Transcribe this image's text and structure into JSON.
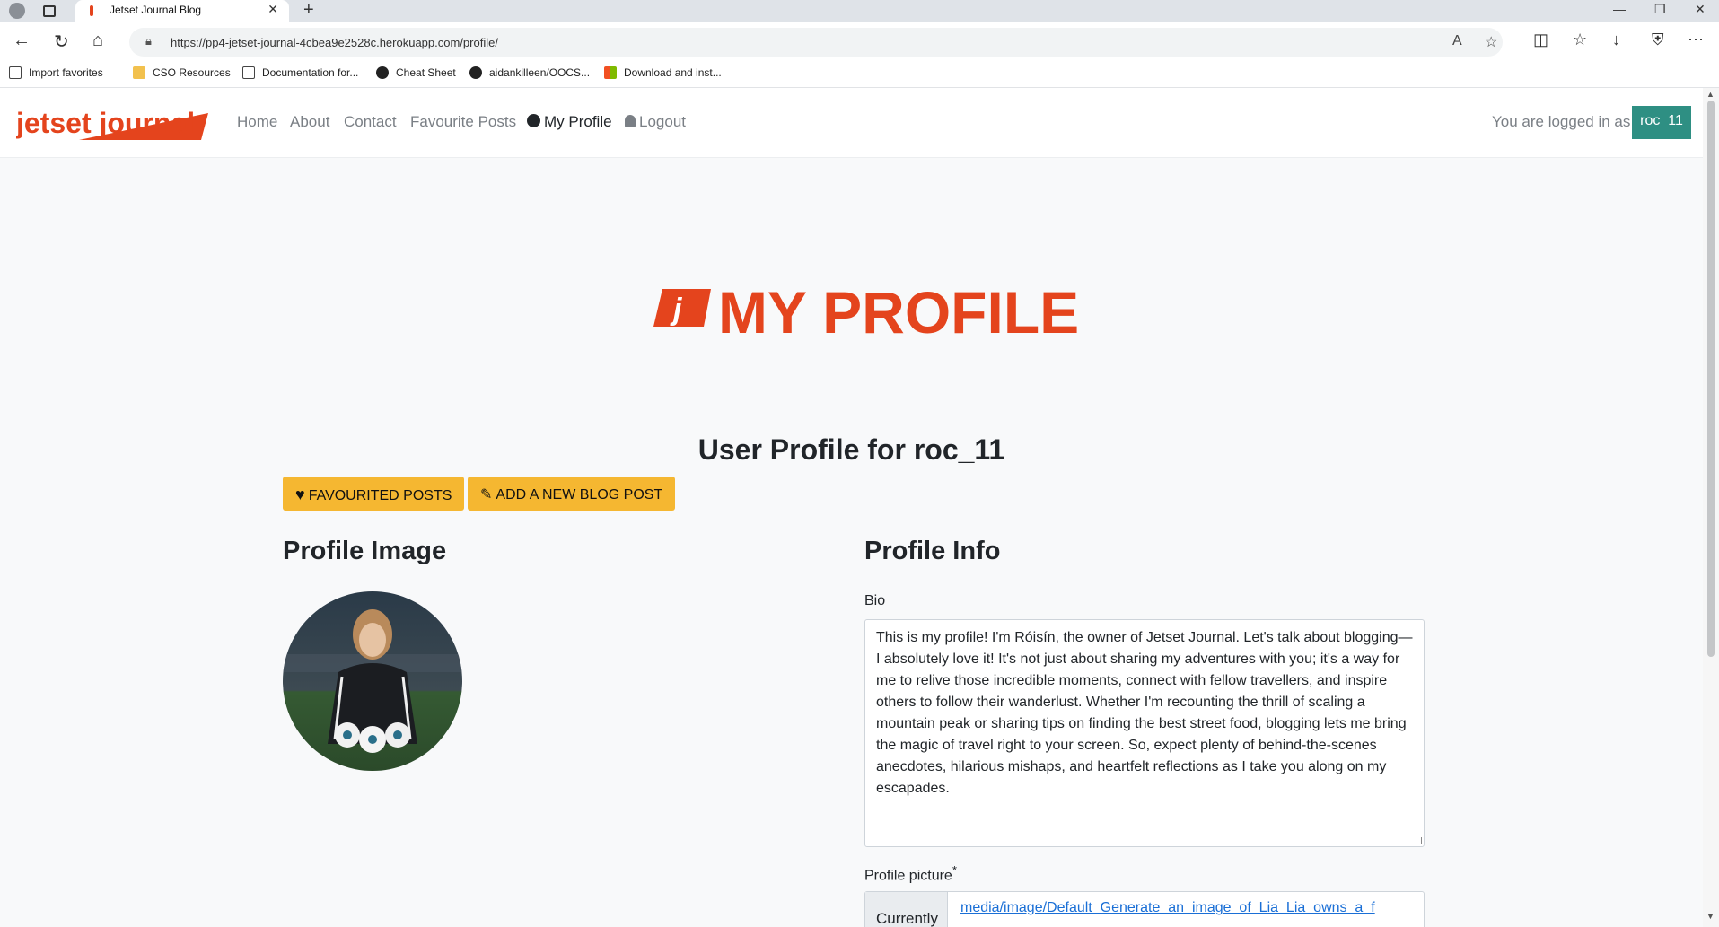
{
  "browser": {
    "tab_title": "Jetset Journal Blog",
    "url": "https://pp4-jetset-journal-4cbea9e2528c.herokuapp.com/profile/",
    "bookmarks": [
      {
        "label": "Import favorites"
      },
      {
        "label": "CSO Resources"
      },
      {
        "label": "Documentation for..."
      },
      {
        "label": "Cheat Sheet"
      },
      {
        "label": "aidankilleen/OOCS..."
      },
      {
        "label": "Download and inst..."
      }
    ]
  },
  "navbar": {
    "logo_text": "jetset journal",
    "links": [
      {
        "label": "Home"
      },
      {
        "label": "About"
      },
      {
        "label": "Contact"
      },
      {
        "label": "Favourite Posts"
      },
      {
        "label": "My Profile"
      },
      {
        "label": "Logout"
      }
    ],
    "logged_in_text": "You are logged in as",
    "username": "roc_11"
  },
  "page": {
    "hero_title": "MY PROFILE",
    "profile_heading": "User Profile for roc_11",
    "buttons": {
      "favourited": "Favourited Posts",
      "add_post": "Add a new blog post"
    },
    "profile_image_heading": "Profile Image",
    "profile_info_heading": "Profile Info",
    "bio_label": "Bio",
    "bio_text": "This is my profile! I'm Róisín, the owner of Jetset Journal. Let's talk about blogging—I absolutely love it! It's not just about sharing my adventures with you; it's a way for me to relive those incredible moments, connect with fellow travellers, and inspire others to follow their wanderlust. Whether I'm recounting the thrill of scaling a mountain peak or sharing tips on finding the best street food, blogging lets me bring the magic of travel right to your screen. So, expect plenty of behind-the-scenes anecdotes, hilarious mishaps, and heartfelt reflections as I take you along on my escapades.",
    "profile_picture_label": "Profile picture",
    "required_mark": "*",
    "currently_label": "Currently",
    "current_file": "media/image/Default_Generate_an_image_of_Lia_Lia_owns_a_f"
  },
  "colors": {
    "brand": "#e4441d",
    "accent_button": "#f5b731",
    "user_badge": "#2e8f83"
  }
}
